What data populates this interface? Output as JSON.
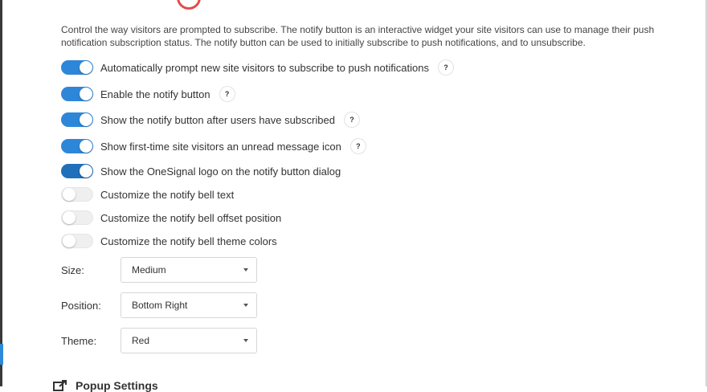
{
  "description": "Control the way visitors are prompted to subscribe. The notify button is an interactive widget your site visitors can use to manage their push notification subscription status. The notify button can be used to initially subscribe to push notifications, and to unsubscribe.",
  "settings": [
    {
      "label": "Automatically prompt new site visitors to subscribe to push notifications",
      "enabled": true,
      "help": "?"
    },
    {
      "label": "Enable the notify button",
      "enabled": true,
      "help": "?"
    },
    {
      "label": "Show the notify button after users have subscribed",
      "enabled": true,
      "help": "?"
    },
    {
      "label": "Show first-time site visitors an unread message icon",
      "enabled": true,
      "help": "?"
    },
    {
      "label": "Show the OneSignal logo on the notify button dialog",
      "enabled": true
    },
    {
      "label": "Customize the notify bell text",
      "enabled": false
    },
    {
      "label": "Customize the notify bell offset position",
      "enabled": false
    },
    {
      "label": "Customize the notify bell theme colors",
      "enabled": false
    }
  ],
  "fields": {
    "size": {
      "label": "Size:",
      "value": "Medium"
    },
    "position": {
      "label": "Position:",
      "value": "Bottom Right"
    },
    "theme": {
      "label": "Theme:",
      "value": "Red"
    }
  },
  "footer": {
    "label": "Popup Settings",
    "icon": "external-link-icon"
  },
  "colors": {
    "toggle_on": "#2e86d8",
    "toggle_off": "#efefef",
    "badge": "#e34c4c"
  }
}
